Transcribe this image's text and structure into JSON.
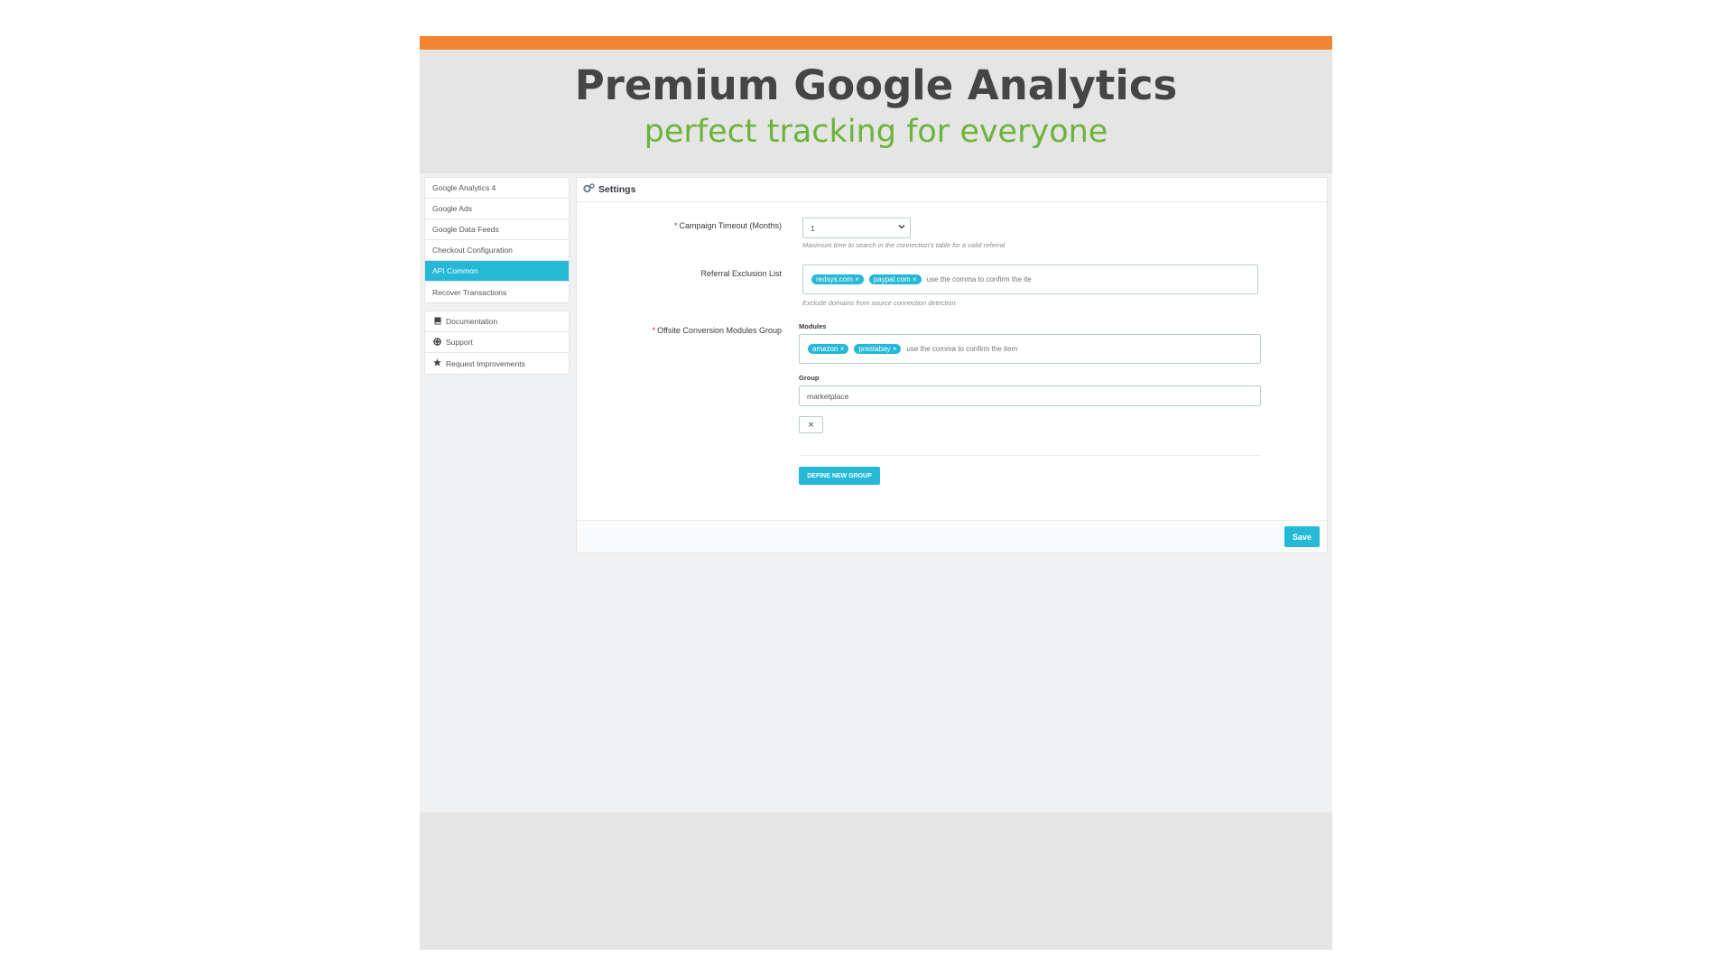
{
  "header": {
    "title": "Premium Google Analytics",
    "subtitle": "perfect tracking for everyone"
  },
  "sidebar": {
    "items": [
      {
        "label": "Google Analytics 4"
      },
      {
        "label": "Google Ads"
      },
      {
        "label": "Google Data Feeds"
      },
      {
        "label": "Checkout Configuration"
      },
      {
        "label": "API Common"
      },
      {
        "label": "Recover Transactions"
      }
    ],
    "help_items": [
      {
        "label": "Documentation",
        "icon": "book-icon"
      },
      {
        "label": "Support",
        "icon": "lifebuoy-icon"
      },
      {
        "label": "Request Improvements",
        "icon": "star-icon"
      }
    ]
  },
  "panel": {
    "title": "Settings",
    "icon": "cogs-icon"
  },
  "form": {
    "campaign_timeout": {
      "label": "Campaign Timeout (Months)",
      "value": "1",
      "help": "Maximum time to search in the connection's table for a valid referral"
    },
    "referral_exclusion": {
      "label": "Referral Exclusion List",
      "tags": [
        "redsys.com",
        "paypal.com"
      ],
      "placeholder": "use the comma to confirm the ite",
      "help": "Exclude domains from source connection detection"
    },
    "offsite_conversion": {
      "label": "Offsite Conversion Modules Group",
      "modules_label": "Modules",
      "module_tags": [
        "amazon",
        "prestabay"
      ],
      "modules_placeholder": "use the comma to confirm the item",
      "group_label": "Group",
      "group_value": "marketplace"
    },
    "remove_icon": "×",
    "define_group_label": "DEFINE NEW GROUP",
    "required_marker": "*",
    "tag_remove_marker": "×"
  },
  "footer": {
    "save_label": "Save"
  },
  "colors": {
    "accent": "#25b9d7",
    "brand_orange": "#f28531",
    "subtitle_green": "#6bb43a",
    "title_gray": "#454545"
  }
}
